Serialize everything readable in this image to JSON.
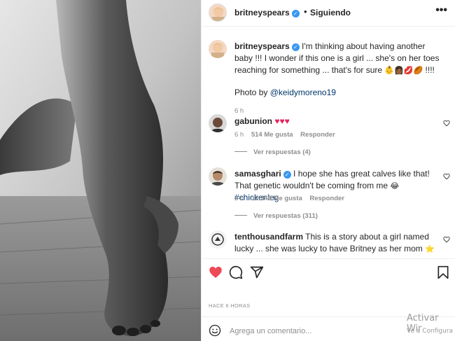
{
  "post": {
    "username": "britneyspears",
    "follow_dot": "•",
    "follow_label": "Siguiendo",
    "more_icon": "•••"
  },
  "caption": {
    "username": "britneyspears",
    "text": "I'm thinking about having another baby !!! I wonder if this one is a girl ... she's on her toes reaching for something ... that's for sure",
    "emojis": "👶👩🏾💋🏉",
    "trailing": " !!!!",
    "photo_by": "Photo by ",
    "photo_credit": "@keidymoreno19",
    "time": "6 h"
  },
  "comments": [
    {
      "username": "gabunion",
      "text": "♥♥♥",
      "time": "6 h",
      "likes": "514 Me gusta",
      "reply": "Responder",
      "view_replies": "Ver respuestas (4)"
    },
    {
      "username": "samasghari",
      "text": "I hope she has great calves like that! That genetic wouldn't be coming from me",
      "emoji": "😂",
      "hashtag": "#chickenleg",
      "time": "6 h",
      "likes": "17.940 Me gusta",
      "reply": "Responder",
      "view_replies": "Ver respuestas (311)"
    },
    {
      "username": "tenthousandfarm",
      "text": "This is a story about a girl named lucky ... she was lucky to have Britney as her mom",
      "emoji": "⭐"
    }
  ],
  "timestamp": "HACE 6 HORAS",
  "add_comment": {
    "placeholder": "Agrega un comentario..."
  },
  "watermark": {
    "line1": "Activar Wir",
    "line2": "Ve a Configura"
  },
  "icons": {
    "like": "heart-icon",
    "comment": "comment-icon",
    "share": "share-icon",
    "save": "bookmark-icon",
    "emoji": "emoji-icon"
  },
  "colors": {
    "like_red": "#ed4956",
    "link": "#00376b",
    "verified": "#3897f0",
    "muted": "#8e8e8e"
  }
}
